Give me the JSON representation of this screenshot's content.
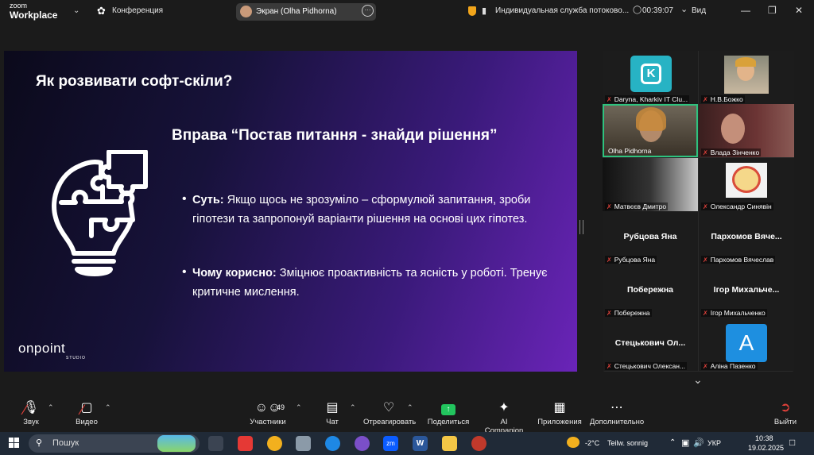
{
  "app": {
    "brand_top": "zoom",
    "brand_main": "Workplace",
    "meeting_label": "Конференция"
  },
  "share": {
    "label": "Экран (Olha Pidhorna)"
  },
  "security": {
    "text": "Индивидуальная служба потоково..."
  },
  "timer": "00:39:07",
  "view_label": "Вид",
  "slide": {
    "title": "Як розвивати софт-скіли?",
    "heading": "Вправа “Постав питання - знайди рішення”",
    "bullet1_bold": "Суть:",
    "bullet1_text": " Якщо щось не зрозуміло – сформулюй запитання, зроби гіпотези та запропонуй варіанти рішення на основі цих гіпотез.",
    "bullet2_bold": "Чому корисно:",
    "bullet2_text": " Зміцнює проактивність та ясність у роботі. Тренує критичне мислення.",
    "logo": "onpoint",
    "logo_sub": "STUDIO"
  },
  "participants": [
    {
      "name": "Daryna, Kharkiv IT Clu...",
      "big": ""
    },
    {
      "name": "Н.В.Божко",
      "big": ""
    },
    {
      "name": "Olha Pidhorna",
      "big": ""
    },
    {
      "name": "Влада Зінченко",
      "big": ""
    },
    {
      "name": "Матвєєв Дмитро",
      "big": ""
    },
    {
      "name": "Олександр Синявін",
      "big": ""
    },
    {
      "name": "Рубцова Яна",
      "big": "Рубцова Яна"
    },
    {
      "name": "Пархомов Вячеслав",
      "big": "Пархомов Вяче..."
    },
    {
      "name": "Побережна",
      "big": "Побережна"
    },
    {
      "name": "Ігор Михальченко",
      "big": "Ігор Михальче..."
    },
    {
      "name": "Стецькович Олексан...",
      "big": "Стецькович Ол..."
    },
    {
      "name": "Аліна Пазенко",
      "big": ""
    }
  ],
  "avatar_letter": "A",
  "toolbar": {
    "audio": "Звук",
    "video": "Видео",
    "participants": "Участники",
    "participants_count": "49",
    "chat": "Чат",
    "react": "Отреагировать",
    "share": "Поделиться",
    "ai": "AI Companion",
    "apps": "Приложения",
    "more": "Дополнительно",
    "leave": "Выйти"
  },
  "taskbar": {
    "search": "Пошук",
    "weather_temp": "-2°C",
    "weather_text": "Teilw. sonnig",
    "lang": "УКР",
    "time": "10:38",
    "date": "19.02.2025"
  },
  "colors": {
    "accent_green": "#2ec27e",
    "mute_red": "#e0413a",
    "share_green": "#22c55e",
    "zoom_blue": "#0b5cff"
  }
}
